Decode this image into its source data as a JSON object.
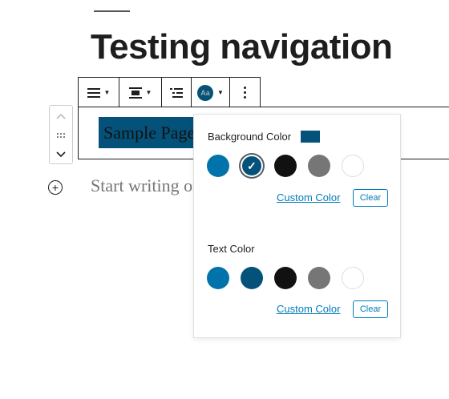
{
  "title": "Testing navigation",
  "block": {
    "text": "Sample Page",
    "placeholder": "Start writing or type / to choose a block"
  },
  "toolbar": {
    "buttons": [
      {
        "icon": "align-justify-icon",
        "dropdown": true
      },
      {
        "icon": "align-center-icon",
        "dropdown": true
      },
      {
        "icon": "list-indent-icon",
        "dropdown": false
      },
      {
        "icon": "text-color-icon",
        "label": "Aa",
        "dropdown": true
      },
      {
        "icon": "more-vertical-icon",
        "dropdown": false
      }
    ]
  },
  "popover": {
    "background": {
      "label": "Background Color",
      "current_color": "#04527a",
      "swatches": [
        "#0073aa",
        "#04527a",
        "#111111",
        "#767676",
        "#ffffff"
      ],
      "selected_index": 1,
      "custom_label": "Custom Color",
      "clear_label": "Clear"
    },
    "text": {
      "label": "Text Color",
      "swatches": [
        "#0073aa",
        "#04527a",
        "#111111",
        "#767676",
        "#ffffff"
      ],
      "custom_label": "Custom Color",
      "clear_label": "Clear"
    }
  },
  "colors": {
    "accent": "#007cba",
    "highlight": "#04527a"
  }
}
